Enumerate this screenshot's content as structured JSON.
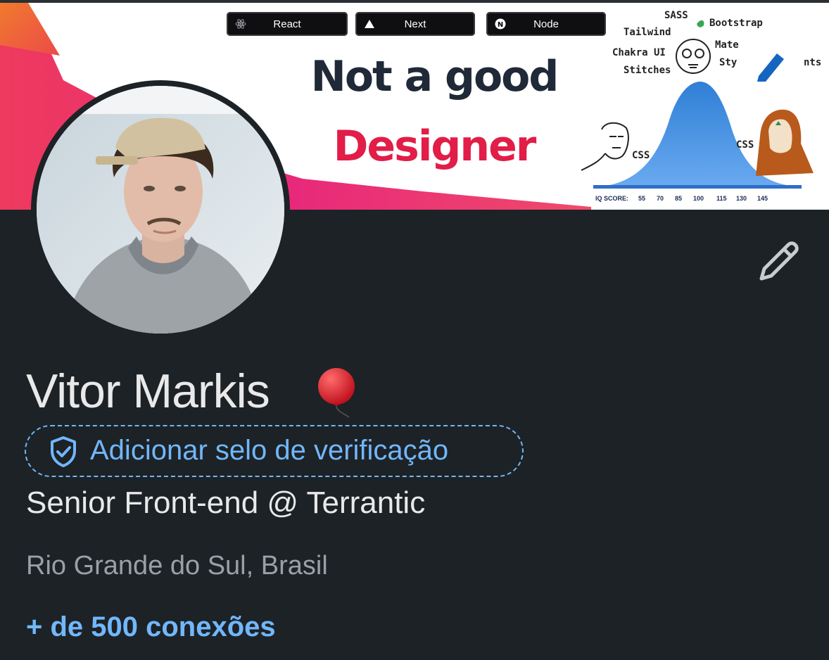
{
  "banner": {
    "pills": [
      {
        "label": "React",
        "icon": "react-icon"
      },
      {
        "label": "Next",
        "icon": "triangle-icon"
      },
      {
        "label": "Node",
        "icon": "node-n-icon"
      }
    ],
    "headline_line1": "Not a good",
    "headline_line2": "Designer",
    "meme_words": {
      "sass": "SASS",
      "tailwind": "Tailwind",
      "bootstrap": "Bootstrap",
      "chakra": "Chakra UI",
      "mate": "Mate",
      "stitches": "Stitches",
      "sty": "Sty",
      "nts": "nts",
      "css_left": "CSS",
      "css_right": "CSS"
    },
    "iq_label": "IQ SCORE:",
    "iq_ticks": [
      "55",
      "70",
      "85",
      "100",
      "115",
      "130",
      "145"
    ]
  },
  "profile": {
    "name": "Vitor Markis",
    "verification_label": "Adicionar selo de verificação",
    "headline": "Senior Front-end @ Terrantic",
    "location": "Rio Grande do Sul, Brasil",
    "connections": "+ de 500 conexões"
  },
  "colors": {
    "background": "#1d2226",
    "link_blue": "#71b7fb",
    "text_primary": "#e9e9e9",
    "text_secondary": "#9aa0a6"
  }
}
